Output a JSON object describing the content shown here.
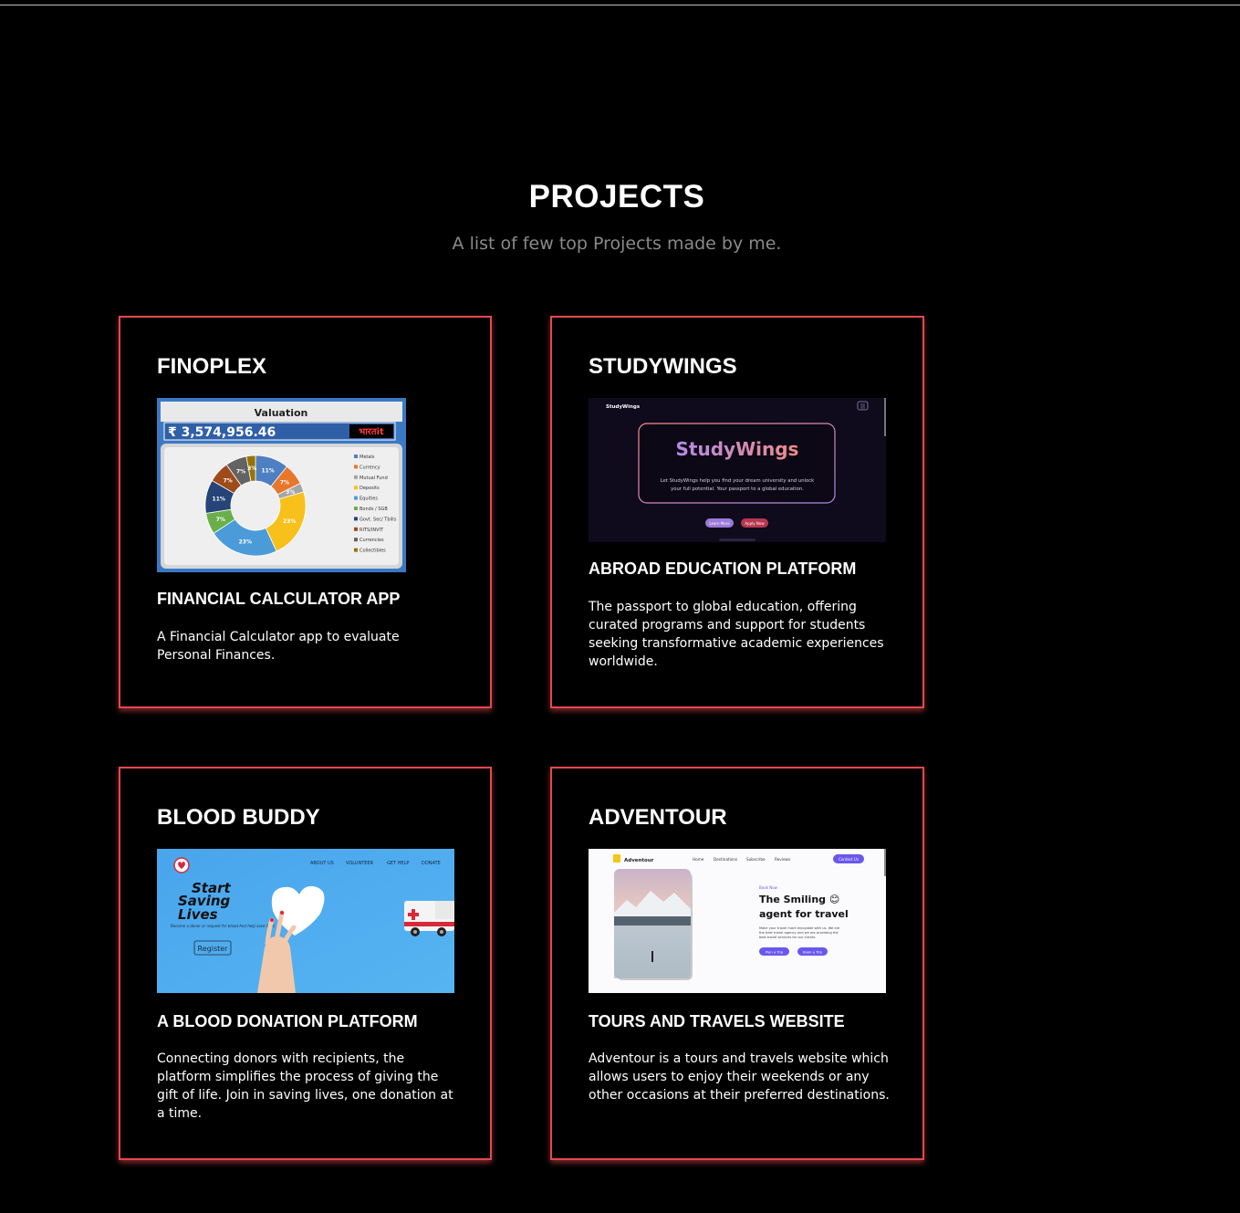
{
  "section": {
    "title": "PROJECTS",
    "subtitle": "A list of few top Projects made by me."
  },
  "colors": {
    "accent": "#e5484d",
    "background": "#000000",
    "subtitle": "#8a8a8a"
  },
  "projects": [
    {
      "name": "FINOPLEX",
      "subtitle": "FINANCIAL CALCULATOR APP",
      "description": "A Financial Calculator app to evaluate Personal Finances.",
      "screenshot": {
        "heading": "Valuation",
        "value": "₹ 3,574,956.46",
        "brand": "भारतit",
        "legend": [
          "Metals",
          "Currency",
          "Mutual Fund",
          "Deposits",
          "Equities",
          "Bonds / SGB",
          "Govt. Sec/ Tbills",
          "RITS/INVIT",
          "Currencies",
          "Collectibles"
        ],
        "slice_labels": [
          "11%",
          "7%",
          "3%",
          "23%",
          "23%",
          "7%",
          "11%",
          "7%",
          "7%",
          "3%"
        ]
      }
    },
    {
      "name": "STUDYWINGS",
      "subtitle": "ABROAD EDUCATION PLATFORM",
      "description": "The passport to global education, offering curated programs and support for students seeking transformative academic experiences worldwide.",
      "screenshot": {
        "brand": "StudyWings",
        "hero_title": "StudyWings",
        "hero_line1": "Let StudyWings help you find your dream university and unlock",
        "hero_line2": "your full potential. Your passport to a global education.",
        "btn_primary": "Learn More",
        "btn_secondary": "Apply Now"
      }
    },
    {
      "name": "BLOOD BUDDY",
      "subtitle": "A BLOOD DONATION PLATFORM",
      "description": "Connecting donors with recipients, the platform simplifies the process of giving the gift of life. Join in saving lives, one donation at a time.",
      "screenshot": {
        "nav": [
          "ABOUT US",
          "VOLUNTEER",
          "GET HELP",
          "DONATE"
        ],
        "hero_line1": "Start",
        "hero_line2": "Saving",
        "hero_line3": "Lives",
        "tagline": "Become a donor or request for blood And help save lives",
        "button": "Register"
      }
    },
    {
      "name": "ADVENTOUR",
      "subtitle": "TOURS AND TRAVELS WEBSITE",
      "description": "Adventour is a tours and travels website which allows users to enjoy their weekends or any other occasions at their preferred destinations.",
      "screenshot": {
        "brand": "Adventour",
        "nav": [
          "Home",
          "Destinations",
          "Subscribe",
          "Reviews"
        ],
        "nav_cta": "Contact Us",
        "eyebrow": "Book Now",
        "hero_line1": "The Smiling 😊",
        "hero_line2": "agent for travel",
        "body_line1": "Make your travel more enjoyable with us. We are",
        "body_line2": "the best travel agency and we are providing the",
        "body_line3": "best travel services for our clients.",
        "btn_primary": "Plan a Trip",
        "btn_secondary": "Book a Trip"
      }
    }
  ]
}
